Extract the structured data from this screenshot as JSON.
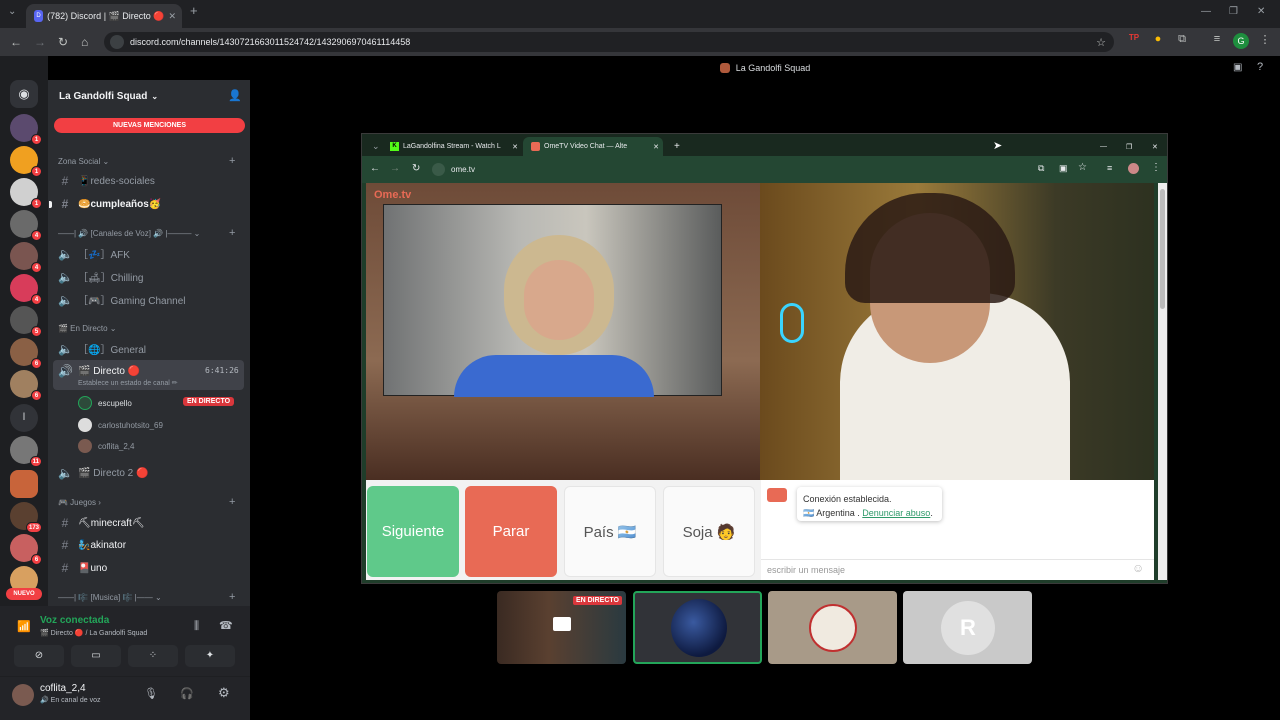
{
  "browser": {
    "tab_title": "(782) Discord | 🎬 Directo 🔴",
    "url": "discord.com/channels/1430721663011524742/1432906970461114458",
    "new_tab": "+"
  },
  "discord": {
    "window_title": "La Gandolfi Squad",
    "server_name": "La Gandolfi Squad",
    "new_mentions": "NUEVAS MENCIONES",
    "rail_badges": [
      "1",
      "1",
      "1",
      "4",
      "4",
      "4",
      "5",
      "6",
      "6",
      "11",
      "173",
      "6"
    ],
    "rail_letter": "l",
    "rail_new": "NUEVO",
    "categories": {
      "social": "Zona Social",
      "voice": "——| 🔊 [Canales de Voz] 🔊 |———",
      "live": "🎬 En Directo",
      "games": "🎮 Juegos",
      "music": "——| 🎼 [Musica] 🎼 |——"
    },
    "channels": {
      "redes": "📱redes-sociales",
      "cumple": "🥯cumpleaños🥳",
      "afk": "［💤］AFK",
      "chilling": "［🛋］Chilling",
      "gaming": "［🎮］Gaming Channel",
      "general": "［🌐］General",
      "directo": "🎬 Directo 🔴",
      "directo_time": "6:41:26",
      "directo_status": "Establece un estado de canal ✏",
      "directo2": "🎬 Directo 2 🔴",
      "minecraft": "⛏minecraft⛏",
      "akinator": "🧞akinator",
      "uno": "🎴uno"
    },
    "voice_users": [
      {
        "name": "escupello",
        "live": "EN DIRECTO"
      },
      {
        "name": "carlostuhotsito_69"
      },
      {
        "name": "coflita_2,4"
      }
    ],
    "voice_panel": {
      "status": "Voz conectada",
      "location": "🎬 Directo 🔴 / La Gandolfi Squad"
    },
    "user": {
      "name": "coflita_2,4",
      "status": "🔊 En canal de voz"
    },
    "stream_live": "EN DIRECTO"
  },
  "inner_browser": {
    "tab1": "LaGandolfina Stream - Watch L",
    "tab2": "OmeTV Video Chat — Alte",
    "url": "ome.tv"
  },
  "ometv": {
    "logo": "Ome.tv",
    "buttons": {
      "next": "Siguiente",
      "stop": "Parar",
      "country": "País 🇦🇷",
      "gender": "Soja 🧑"
    },
    "connection": "Conexión establecida.",
    "country_line": "🇦🇷 Argentina .",
    "report": "Denunciar abuso",
    "input_placeholder": "escribir un mensaje"
  },
  "colors": {
    "discord_red": "#f23f43",
    "blurple": "#5865f2",
    "ome_green": "#5fc98a",
    "ome_red": "#e86a55",
    "voice_green": "#23a559"
  }
}
